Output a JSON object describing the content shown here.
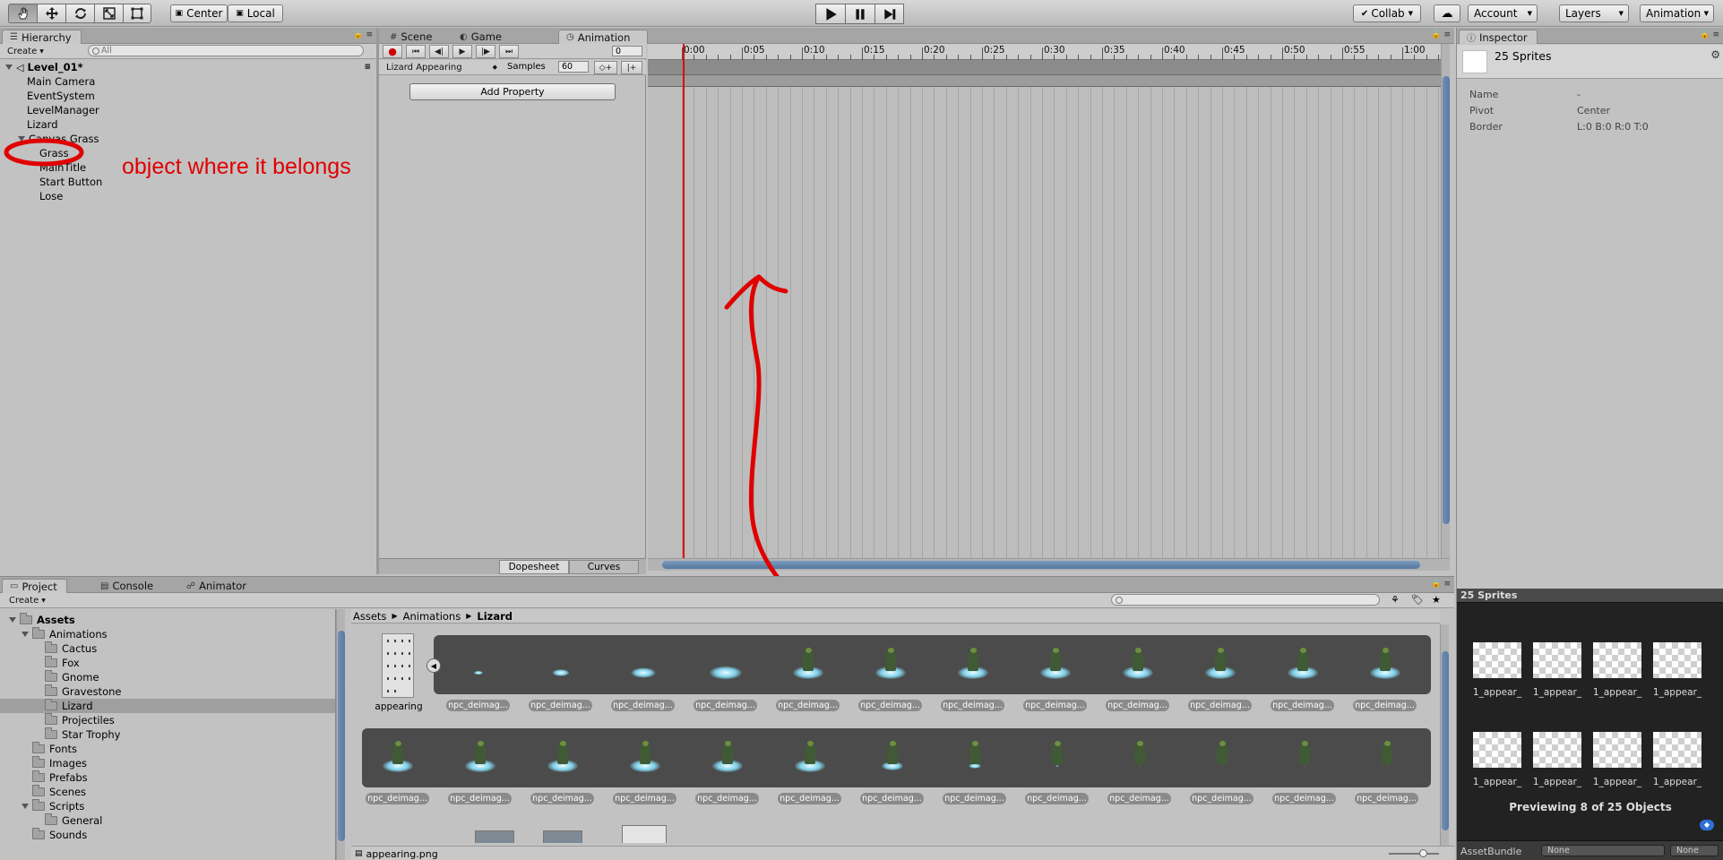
{
  "toolbar": {
    "pivot_mode": "Center",
    "pivot_rotation": "Local",
    "collab": "Collab",
    "account": "Account",
    "layers": "Layers",
    "layout": "Animation"
  },
  "hierarchy": {
    "tab": "Hierarchy",
    "create": "Create",
    "search_placeholder": "All",
    "scene": "Level_01*",
    "items": [
      "Main Camera",
      "EventSystem",
      "LevelManager",
      "Lizard",
      "Canvas Grass",
      "Grass",
      "MainTitle",
      "Start Button",
      "Lose"
    ]
  },
  "annotation": {
    "text": "object where it belongs",
    "color": "#e00000"
  },
  "center_tabs": [
    "Scene",
    "Game",
    "Animation"
  ],
  "animation": {
    "frame": "0",
    "clip": "Lizard Appearing",
    "samples_label": "Samples",
    "samples": "60",
    "add_property": "Add Property",
    "ruler": [
      "0:00",
      "0:05",
      "0:10",
      "0:15",
      "0:20",
      "0:25",
      "0:30",
      "0:35",
      "0:40",
      "0:45",
      "0:50",
      "0:55",
      "1:00"
    ],
    "bottom_tabs": [
      "Dopesheet",
      "Curves"
    ]
  },
  "inspector": {
    "tab": "Inspector",
    "title": "25 Sprites",
    "fields": [
      {
        "label": "Name",
        "value": "-"
      },
      {
        "label": "Pivot",
        "value": "Center"
      },
      {
        "label": "Border",
        "value": "L:0 B:0 R:0 T:0"
      }
    ],
    "preview_header": "25 Sprites",
    "preview_labels": [
      "1_appear_",
      "1_appear_",
      "1_appear_",
      "1_appear_",
      "1_appear_",
      "1_appear_",
      "1_appear_",
      "1_appear_"
    ],
    "preview_caption": "Previewing 8 of 25 Objects",
    "assetbundle_label": "AssetBundle",
    "assetbundle_value": "None",
    "assetbundle_variant": "None"
  },
  "bottom_tabs": [
    "Project",
    "Console",
    "Animator"
  ],
  "project": {
    "create": "Create",
    "breadcrumb": [
      "Assets",
      "Animations",
      "Lizard"
    ],
    "tree": [
      {
        "label": "Assets",
        "depth": 0
      },
      {
        "label": "Animations",
        "depth": 1
      },
      {
        "label": "Cactus",
        "depth": 2
      },
      {
        "label": "Fox",
        "depth": 2
      },
      {
        "label": "Gnome",
        "depth": 2
      },
      {
        "label": "Gravestone",
        "depth": 2
      },
      {
        "label": "Lizard",
        "depth": 2
      },
      {
        "label": "Projectiles",
        "depth": 2
      },
      {
        "label": "Star Trophy",
        "depth": 2
      },
      {
        "label": "Fonts",
        "depth": 1
      },
      {
        "label": "Images",
        "depth": 1
      },
      {
        "label": "Prefabs",
        "depth": 1
      },
      {
        "label": "Scenes",
        "depth": 1
      },
      {
        "label": "Scripts",
        "depth": 1
      },
      {
        "label": "General",
        "depth": 2
      },
      {
        "label": "Sounds",
        "depth": 1
      }
    ],
    "appearing_label": "appearing",
    "frame_label": "npc_deimag...",
    "selected_file": "appearing.png"
  }
}
